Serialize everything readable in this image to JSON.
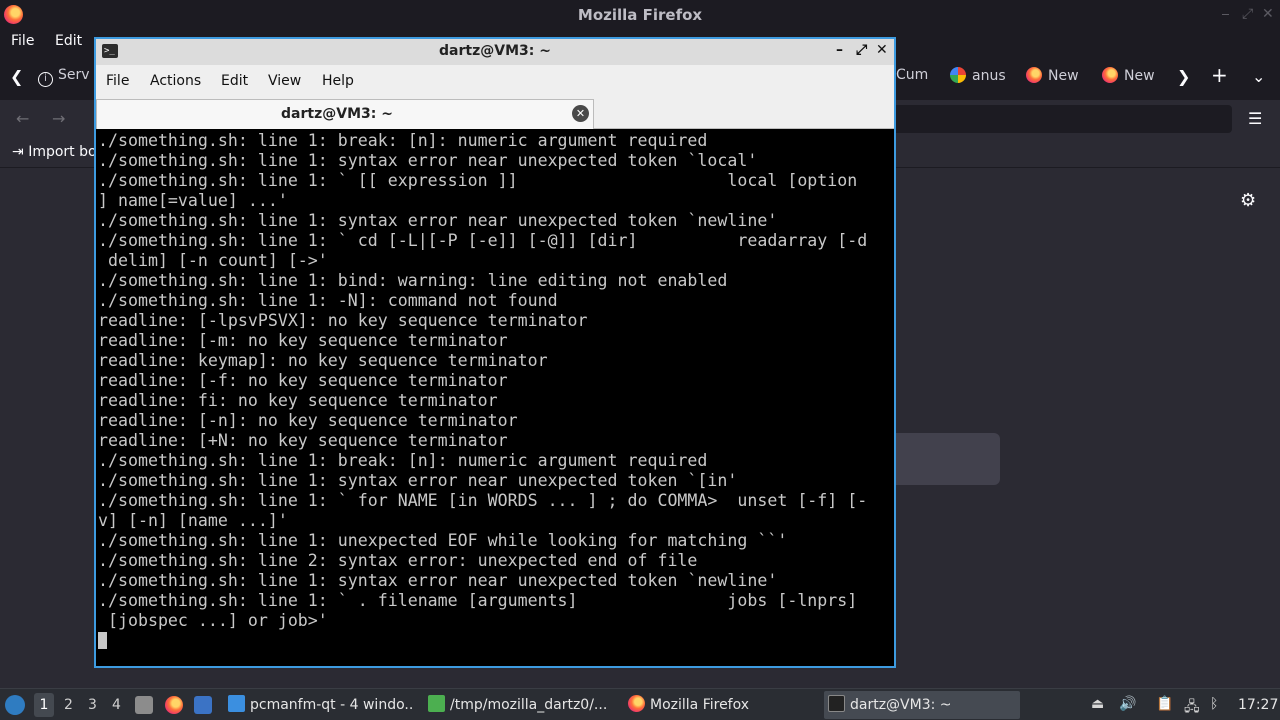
{
  "firefox": {
    "title": "Mozilla Firefox",
    "menu": [
      "File",
      "Edit"
    ],
    "tabs": {
      "partial_left_label": "Serv",
      "partial_right_label": "Cum",
      "google_tab_label": "anus",
      "new_tab_1_label": "New",
      "new_tab_2_label": "New"
    },
    "bookmarks": {
      "import_label": "Import bo"
    },
    "icons": [
      "back-icon",
      "forward-icon",
      "reload-icon",
      "menu-icon",
      "settings-gear-icon",
      "new-tab-plus-icon",
      "list-all-tabs-chevron-icon"
    ]
  },
  "terminal": {
    "window_title": "dartz@VM3: ~",
    "menu": [
      "File",
      "Actions",
      "Edit",
      "View",
      "Help"
    ],
    "tab_label": "dartz@VM3: ~",
    "lines": [
      "./something.sh: line 1: break: [n]: numeric argument required",
      "./something.sh: line 1: syntax error near unexpected token `local'",
      "./something.sh: line 1: ` [[ expression ]]                     local [option",
      "] name[=value] ...'",
      "./something.sh: line 1: syntax error near unexpected token `newline'",
      "./something.sh: line 1: ` cd [-L|[-P [-e]] [-@]] [dir]          readarray [-d",
      " delim] [-n count] [->'",
      "./something.sh: line 1: bind: warning: line editing not enabled",
      "./something.sh: line 1: -N]: command not found",
      "readline: [-lpsvPSVX]: no key sequence terminator",
      "readline: [-m: no key sequence terminator",
      "readline: keymap]: no key sequence terminator",
      "readline: [-f: no key sequence terminator",
      "readline: fi: no key sequence terminator",
      "readline: [-n]: no key sequence terminator",
      "readline: [+N: no key sequence terminator",
      "./something.sh: line 1: break: [n]: numeric argument required",
      "./something.sh: line 1: syntax error near unexpected token `[in'",
      "./something.sh: line 1: ` for NAME [in WORDS ... ] ; do COMMA>  unset [-f] [-",
      "v] [-n] [name ...]'",
      "./something.sh: line 1: unexpected EOF while looking for matching ``'",
      "./something.sh: line 2: syntax error: unexpected end of file",
      "./something.sh: line 1: syntax error near unexpected token `newline'",
      "./something.sh: line 1: ` . filename [arguments]               jobs [-lnprs]",
      " [jobspec ...] or job>'"
    ]
  },
  "taskbar": {
    "workspaces": [
      "1",
      "2",
      "3",
      "4"
    ],
    "tasks": [
      {
        "label": "pcmanfm-qt - 4 windo...",
        "icon": "folder-icon"
      },
      {
        "label": "/tmp/mozilla_dartz0/...",
        "icon": "archive-icon"
      },
      {
        "label": "Mozilla Firefox",
        "icon": "firefox-icon"
      },
      {
        "label": "dartz@VM3: ~",
        "icon": "terminal-icon"
      }
    ],
    "clock": "17:27"
  },
  "colors": {
    "terminal_border": "#3d9be0",
    "terminal_text": "#c8c8c8",
    "firefox_dark": "#1c1b22",
    "firefox_content": "#2b2a33"
  }
}
